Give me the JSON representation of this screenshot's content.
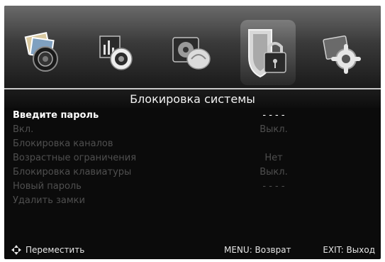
{
  "header": {
    "title": "Блокировка системы"
  },
  "top_icons": [
    {
      "name": "picture-menu-icon",
      "selected": false
    },
    {
      "name": "sound-menu-icon",
      "selected": false
    },
    {
      "name": "channel-menu-icon",
      "selected": false
    },
    {
      "name": "lock-menu-icon",
      "selected": true
    },
    {
      "name": "settings-menu-icon",
      "selected": false
    }
  ],
  "menu": {
    "items": [
      {
        "label": "Введите пароль",
        "value": "- - - -",
        "active": true
      },
      {
        "label": "Вкл.",
        "value": "Выкл.",
        "active": false
      },
      {
        "label": "Блокировка каналов",
        "value": "",
        "active": false
      },
      {
        "label": "Возрастные ограничения",
        "value": "Нет",
        "active": false
      },
      {
        "label": "Блокировка клавиатуры",
        "value": "Выкл.",
        "active": false
      },
      {
        "label": "Новый пароль",
        "value": "- - - -",
        "active": false
      },
      {
        "label": "Удалить замки",
        "value": "",
        "active": false
      }
    ]
  },
  "footer": {
    "move_label": "Переместить",
    "menu_hint": "MENU: Возврат",
    "exit_hint": "EXIT: Выход"
  },
  "colors": {
    "background": "#0b0b0b",
    "active_text": "#ffffff",
    "inactive_text": "#4f4f4f"
  }
}
